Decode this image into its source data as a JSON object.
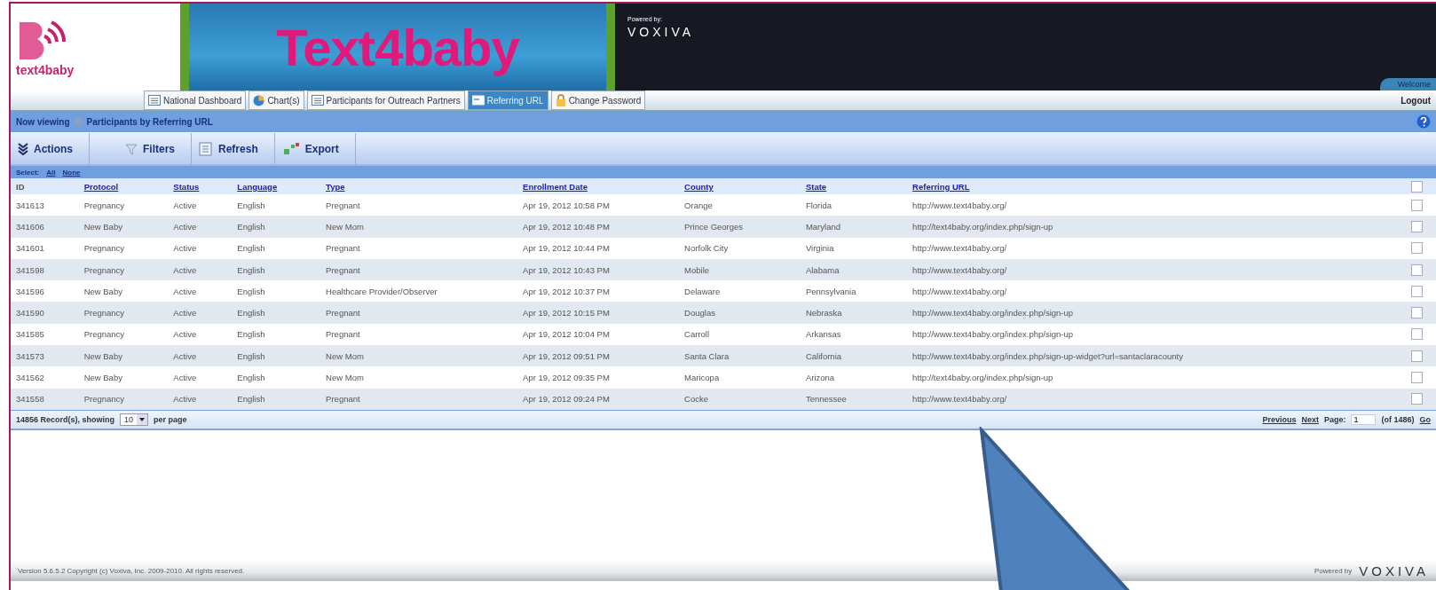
{
  "header": {
    "logo_text": "text4baby",
    "banner_title": "Text4baby",
    "powered_by": "Powered by:",
    "brand": "VOXIVA",
    "welcome": "Welcome"
  },
  "tabs": [
    {
      "label": "National Dashboard",
      "kind": "list",
      "selected": false
    },
    {
      "label": "Chart(s)",
      "kind": "chart",
      "selected": false
    },
    {
      "label": "Participants for Outreach Partners",
      "kind": "list",
      "selected": false
    },
    {
      "label": "Referring URL",
      "kind": "link",
      "selected": true
    },
    {
      "label": "Change Password",
      "kind": "lock",
      "selected": false
    }
  ],
  "logout": "Logout",
  "view": {
    "prefix": "Now viewing",
    "title": "Participants by Referring URL"
  },
  "toolbar": [
    {
      "label": "Actions",
      "kind": "actions"
    },
    {
      "label": "Filters",
      "kind": "filter"
    },
    {
      "label": "Refresh",
      "kind": "refresh"
    },
    {
      "label": "Export",
      "kind": "export"
    }
  ],
  "select": {
    "label": "Select:",
    "links": [
      "All",
      "None"
    ]
  },
  "table": {
    "columns": [
      "ID",
      "Protocol",
      "Status",
      "Language",
      "Type",
      "Enrollment Date",
      "County",
      "State",
      "Referring URL"
    ],
    "all_checked": false,
    "rows": [
      {
        "cells": [
          "341613",
          "Pregnancy",
          "Active",
          "English",
          "Pregnant",
          "Apr 19, 2012 10:58 PM",
          "Orange",
          "Florida",
          "http://www.text4baby.org/"
        ],
        "checked": false
      },
      {
        "cells": [
          "341606",
          "New Baby",
          "Active",
          "English",
          "New Mom",
          "Apr 19, 2012 10:48 PM",
          "Prince Georges",
          "Maryland",
          "http://text4baby.org/index.php/sign-up"
        ],
        "checked": false
      },
      {
        "cells": [
          "341601",
          "Pregnancy",
          "Active",
          "English",
          "Pregnant",
          "Apr 19, 2012 10:44 PM",
          "Norfolk City",
          "Virginia",
          "http://www.text4baby.org/"
        ],
        "checked": false
      },
      {
        "cells": [
          "341598",
          "Pregnancy",
          "Active",
          "English",
          "Pregnant",
          "Apr 19, 2012 10:43 PM",
          "Mobile",
          "Alabama",
          "http://www.text4baby.org/"
        ],
        "checked": false
      },
      {
        "cells": [
          "341596",
          "New Baby",
          "Active",
          "English",
          "Healthcare Provider/Observer",
          "Apr 19, 2012 10:37 PM",
          "Delaware",
          "Pennsylvania",
          "http://www.text4baby.org/"
        ],
        "checked": false
      },
      {
        "cells": [
          "341590",
          "Pregnancy",
          "Active",
          "English",
          "Pregnant",
          "Apr 19, 2012 10:15 PM",
          "Douglas",
          "Nebraska",
          "http://www.text4baby.org/index.php/sign-up"
        ],
        "checked": false
      },
      {
        "cells": [
          "341585",
          "Pregnancy",
          "Active",
          "English",
          "Pregnant",
          "Apr 19, 2012 10:04 PM",
          "Carroll",
          "Arkansas",
          "http://www.text4baby.org/index.php/sign-up"
        ],
        "checked": false
      },
      {
        "cells": [
          "341573",
          "New Baby",
          "Active",
          "English",
          "New Mom",
          "Apr 19, 2012 09:51 PM",
          "Santa Clara",
          "California",
          "http://www.text4baby.org/index.php/sign-up-widget?url=santaclaracounty"
        ],
        "checked": false
      },
      {
        "cells": [
          "341562",
          "New Baby",
          "Active",
          "English",
          "New Mom",
          "Apr 19, 2012 09:35 PM",
          "Maricopa",
          "Arizona",
          "http://text4baby.org/index.php/sign-up"
        ],
        "checked": false
      },
      {
        "cells": [
          "341558",
          "Pregnancy",
          "Active",
          "English",
          "Pregnant",
          "Apr 19, 2012 09:24 PM",
          "Cocke",
          "Tennessee",
          "http://www.text4baby.org/"
        ],
        "checked": false
      }
    ]
  },
  "pager": {
    "records": "14856 Record(s), showing",
    "per_page": "10",
    "per_page_suffix": "per page",
    "previous": "Previous",
    "next": "Next",
    "page_label": "Page:",
    "page": "1",
    "of": "(of 1486)",
    "go": "Go"
  },
  "footer": {
    "version": "Version 5.6.5.2 Copyright (c) Voxiva, Inc. 2009-2010. All rights reserved.",
    "powered_by": "Powered by",
    "brand": "VOXIVA"
  }
}
